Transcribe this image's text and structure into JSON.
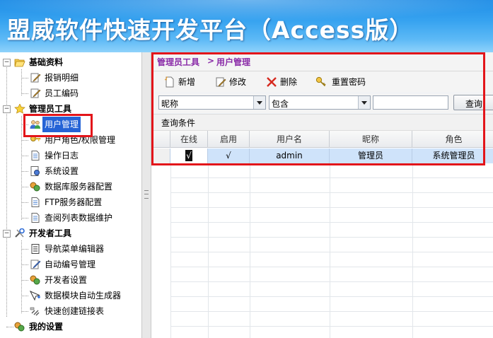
{
  "app": {
    "title": "盟威软件快速开发平台（Access版）"
  },
  "tree": {
    "groups": [
      {
        "label": "基础资料",
        "items": [
          {
            "label": "报销明细"
          },
          {
            "label": "员工编码"
          }
        ]
      },
      {
        "label": "管理员工具",
        "items": [
          {
            "label": "用户管理",
            "selected": true
          },
          {
            "label": "用户角色/权限管理"
          },
          {
            "label": "操作日志"
          },
          {
            "label": "系统设置"
          },
          {
            "label": "数据库服务器配置"
          },
          {
            "label": "FTP服务器配置"
          },
          {
            "label": "查阅列表数据维护"
          }
        ]
      },
      {
        "label": "开发者工具",
        "items": [
          {
            "label": "导航菜单编辑器"
          },
          {
            "label": "自动编号管理"
          },
          {
            "label": "开发者设置"
          },
          {
            "label": "数据模块自动生成器"
          },
          {
            "label": "快速创建链接表"
          }
        ]
      },
      {
        "label": "我的设置",
        "items": []
      }
    ]
  },
  "breadcrumb": {
    "parent": "管理员工具",
    "separator": ">",
    "current": "用户管理"
  },
  "toolbar": {
    "add": "新增",
    "edit": "修改",
    "delete": "删除",
    "reset_password": "重置密码"
  },
  "filter": {
    "field": "昵称",
    "operator": "包含",
    "value": "",
    "query_button": "查询"
  },
  "conditions": {
    "label": "查询条件"
  },
  "grid": {
    "columns": [
      "在线",
      "启用",
      "用户名",
      "昵称",
      "角色"
    ],
    "rows": [
      {
        "online": "√",
        "enabled": "√",
        "username": "admin",
        "nickname": "管理员",
        "role": "系统管理员"
      }
    ]
  },
  "colors": {
    "banner": "#37a3f0",
    "highlight": "#e3151a",
    "selection": "#2563d6",
    "crumb": "#8a2ba8"
  }
}
